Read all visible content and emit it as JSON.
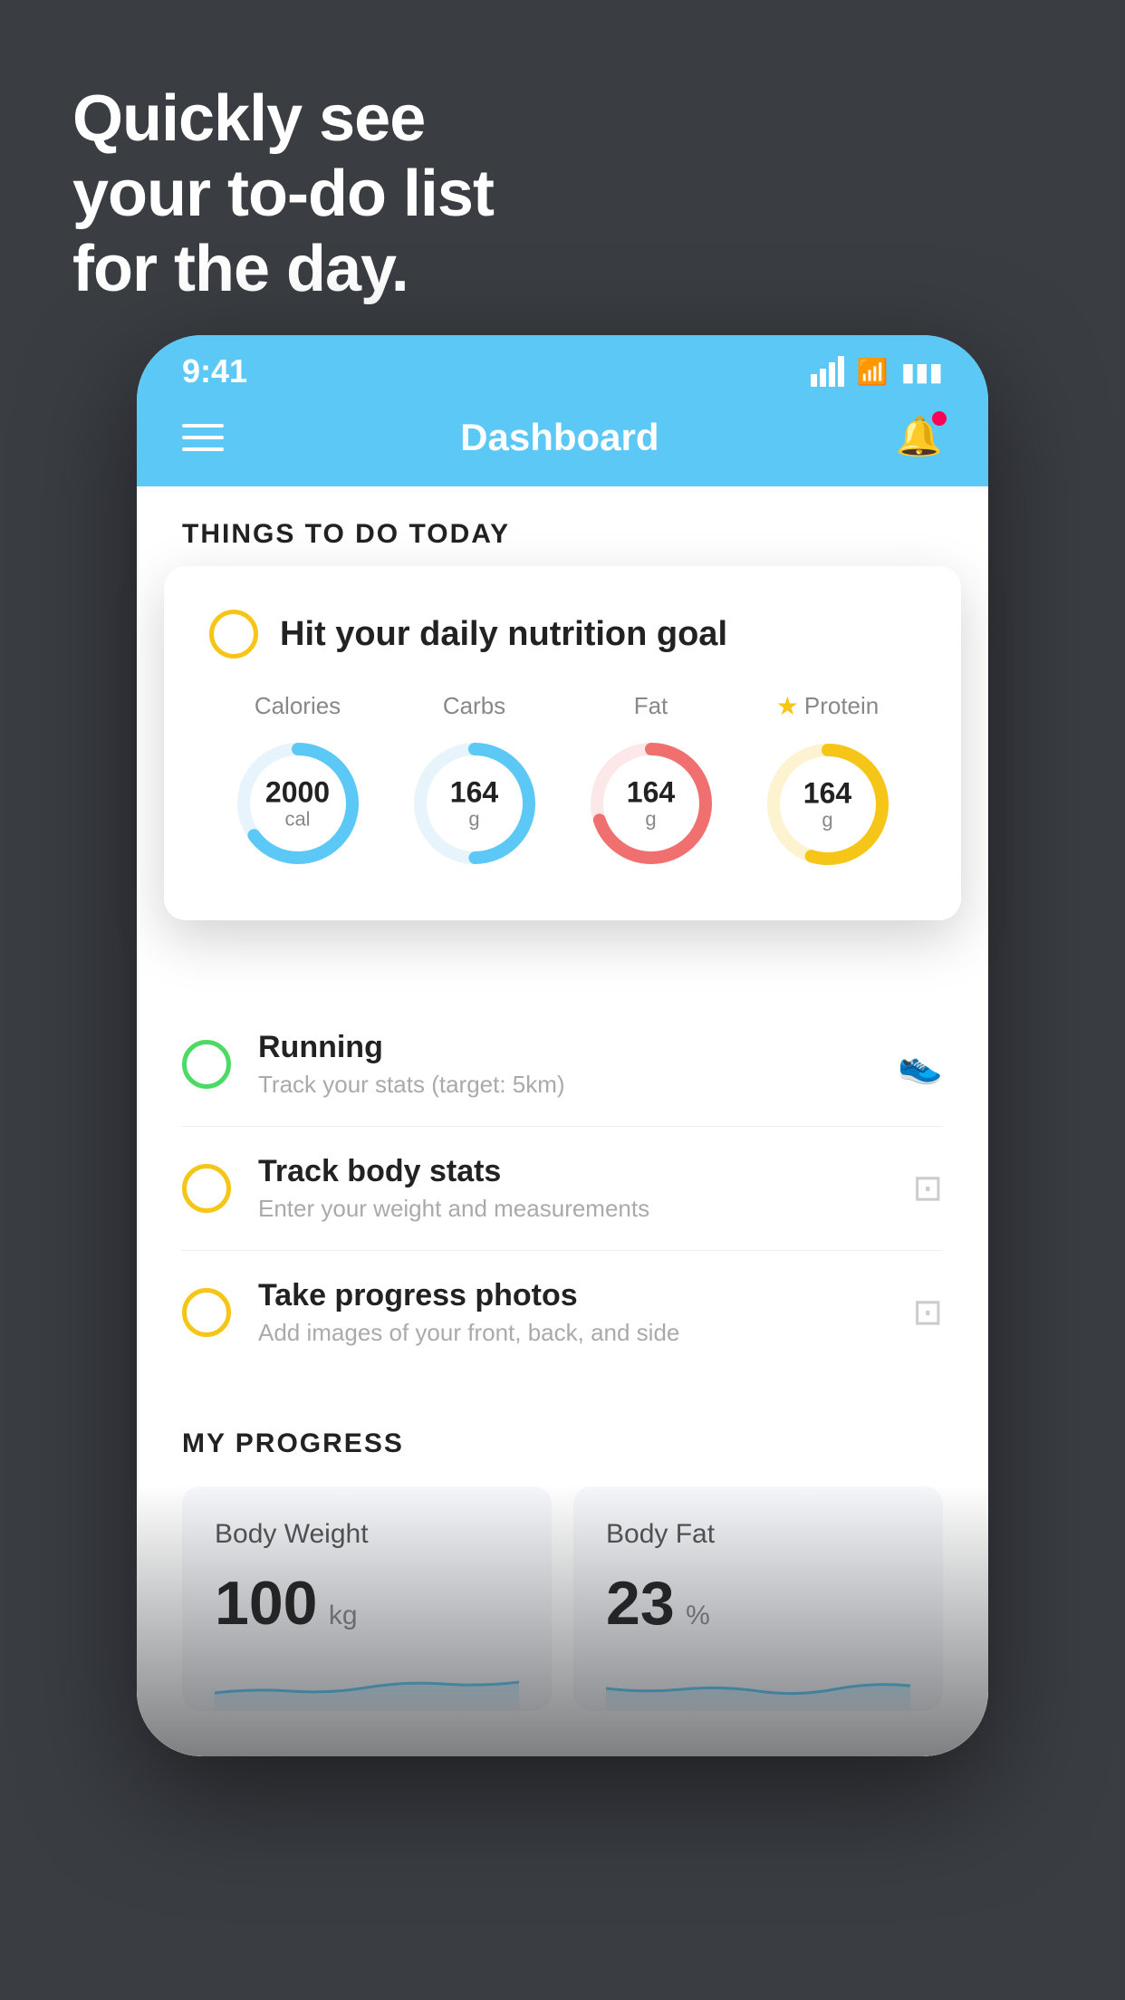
{
  "hero": {
    "line1": "Quickly see",
    "line2": "your to-do list",
    "line3": "for the day."
  },
  "phone": {
    "status": {
      "time": "9:41"
    },
    "navbar": {
      "title": "Dashboard"
    },
    "section_header": "THINGS TO DO TODAY",
    "floating_card": {
      "task_title": "Hit your daily nutrition goal",
      "nutrition": [
        {
          "label": "Calories",
          "value": "2000",
          "unit": "cal",
          "color": "#5bc8f5",
          "percent": 65
        },
        {
          "label": "Carbs",
          "value": "164",
          "unit": "g",
          "color": "#5bc8f5",
          "percent": 50
        },
        {
          "label": "Fat",
          "value": "164",
          "unit": "g",
          "color": "#f07070",
          "percent": 70
        },
        {
          "label": "Protein",
          "value": "164",
          "unit": "g",
          "color": "#f5c518",
          "percent": 55,
          "star": true
        }
      ]
    },
    "todo_items": [
      {
        "title": "Running",
        "subtitle": "Track your stats (target: 5km)",
        "circle_color": "green",
        "icon": "👟"
      },
      {
        "title": "Track body stats",
        "subtitle": "Enter your weight and measurements",
        "circle_color": "yellow",
        "icon": "⚖️"
      },
      {
        "title": "Take progress photos",
        "subtitle": "Add images of your front, back, and side",
        "circle_color": "yellow",
        "icon": "🖼️"
      }
    ],
    "progress": {
      "header": "MY PROGRESS",
      "cards": [
        {
          "title": "Body Weight",
          "value": "100",
          "unit": "kg"
        },
        {
          "title": "Body Fat",
          "value": "23",
          "unit": "%"
        }
      ]
    }
  }
}
